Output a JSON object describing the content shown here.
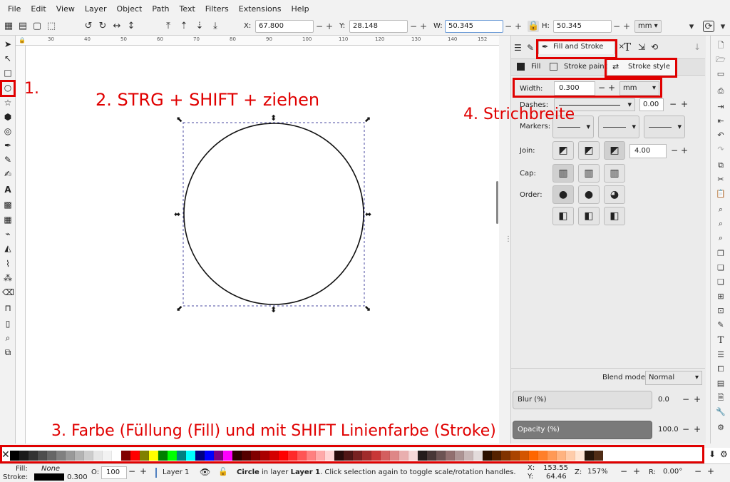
{
  "menu": [
    "File",
    "Edit",
    "View",
    "Layer",
    "Object",
    "Path",
    "Text",
    "Filters",
    "Extensions",
    "Help"
  ],
  "toolbar": {
    "x_label": "X:",
    "x_value": "67.800",
    "y_label": "Y:",
    "y_value": "28.148",
    "w_label": "W:",
    "w_value": "50.345",
    "h_label": "H:",
    "h_value": "50.345",
    "unit": "mm"
  },
  "ruler": [
    "30",
    "40",
    "50",
    "60",
    "70",
    "80",
    "90",
    "100",
    "110",
    "120",
    "130",
    "140",
    "150"
  ],
  "ruler_end": "152",
  "panel": {
    "tab_label": "Fill and Stroke",
    "tab_close": "×",
    "fill_tab": "Fill",
    "stroke_paint_tab": "Stroke paint",
    "stroke_style_tab": "Stroke style",
    "width_label": "Width:",
    "width_value": "0.300",
    "width_unit": "mm",
    "dashes_label": "Dashes:",
    "dashes_value": "0.00",
    "markers_label": "Markers:",
    "join_label": "Join:",
    "join_value": "4.00",
    "cap_label": "Cap:",
    "order_label": "Order:",
    "blend_label": "Blend mode:",
    "blend_value": "Normal",
    "blur_label": "Blur (%)",
    "blur_value": "0.0",
    "opacity_label": "Opacity (%)",
    "opacity_value": "100.0"
  },
  "status": {
    "fill_label": "Fill:",
    "fill_value": "None",
    "stroke_label": "Stroke:",
    "stroke_width": "0.300",
    "o_label": "O:",
    "o_value": "100",
    "layer": "Layer 1",
    "msg_obj": "Circle",
    "msg_mid": " in layer ",
    "msg_layer": "Layer 1",
    "msg_rest": ". Click selection again to toggle scale/rotation handles.",
    "cx_label": "X:",
    "cx_value": "153.55",
    "cy_label": "Y:",
    "cy_value": "64.46",
    "z_label": "Z:",
    "z_value": "157%",
    "r_label": "R:",
    "r_value": "0.00°"
  },
  "annotations": {
    "a1": "1.",
    "a2": "2. STRG + SHIFT + ziehen",
    "a3": "3. Farbe (Füllung (Fill) und mit SHIFT Linienfarbe (Stroke)",
    "a4": "4. Strichbreite"
  },
  "palette_colors": [
    "#000000",
    "#1a1a1a",
    "#333333",
    "#4d4d4d",
    "#666666",
    "#808080",
    "#999999",
    "#b3b3b3",
    "#cccccc",
    "#e6e6e6",
    "#f2f2f2",
    "#ffffff",
    "#800000",
    "#ff0000",
    "#808000",
    "#ffff00",
    "#008000",
    "#00ff00",
    "#008080",
    "#00ffff",
    "#000080",
    "#0000ff",
    "#800080",
    "#ff00ff",
    "#2b0000",
    "#550000",
    "#800000",
    "#aa0000",
    "#d40000",
    "#ff0000",
    "#ff2a2a",
    "#ff5555",
    "#ff8080",
    "#ffaaaa",
    "#ffd5d5",
    "#280b0b",
    "#501616",
    "#782121",
    "#a02c2c",
    "#c83737",
    "#d35f5f",
    "#de8787",
    "#e9afaf",
    "#f4d7d7",
    "#241c1c",
    "#483737",
    "#6c5353",
    "#916f6f",
    "#ac9393",
    "#c8b7b7",
    "#e3dbdb",
    "#2b1100",
    "#552200",
    "#803300",
    "#aa4400",
    "#d45500",
    "#ff6600",
    "#ff7f2a",
    "#ff9955",
    "#ffb380",
    "#ffccaa",
    "#ffe6d5",
    "#28170b",
    "#502d16"
  ]
}
